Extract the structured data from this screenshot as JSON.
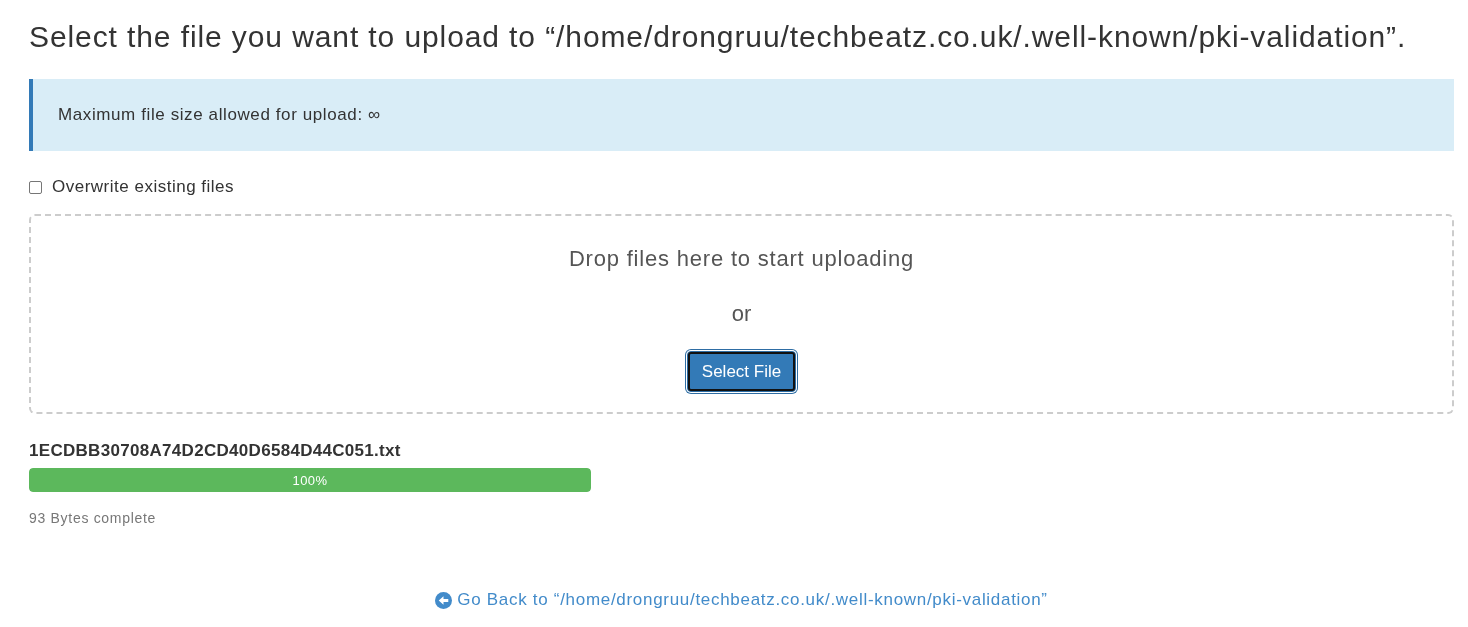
{
  "heading": "Select the file you want to upload to “/home/drongruu/techbeatz.co.uk/.well-known/pki-validation”.",
  "notice": {
    "text": "Maximum file size allowed for upload: ∞"
  },
  "overwrite": {
    "label": "Overwrite existing files",
    "checked": false
  },
  "dropzone": {
    "prompt": "Drop files here to start uploading",
    "separator": "or",
    "button": {
      "label": "Select File",
      "focused": true
    }
  },
  "uploads": [
    {
      "filename": "1ECDBB30708A74D2CD40D6584D44C051.txt",
      "level": 1,
      "percent": "100%",
      "status": "93 Bytes complete"
    }
  ],
  "back_link": {
    "text": "Go Back to “/home/drongruu/techbeatz.co.uk/.well-known/pki-validation”"
  }
}
